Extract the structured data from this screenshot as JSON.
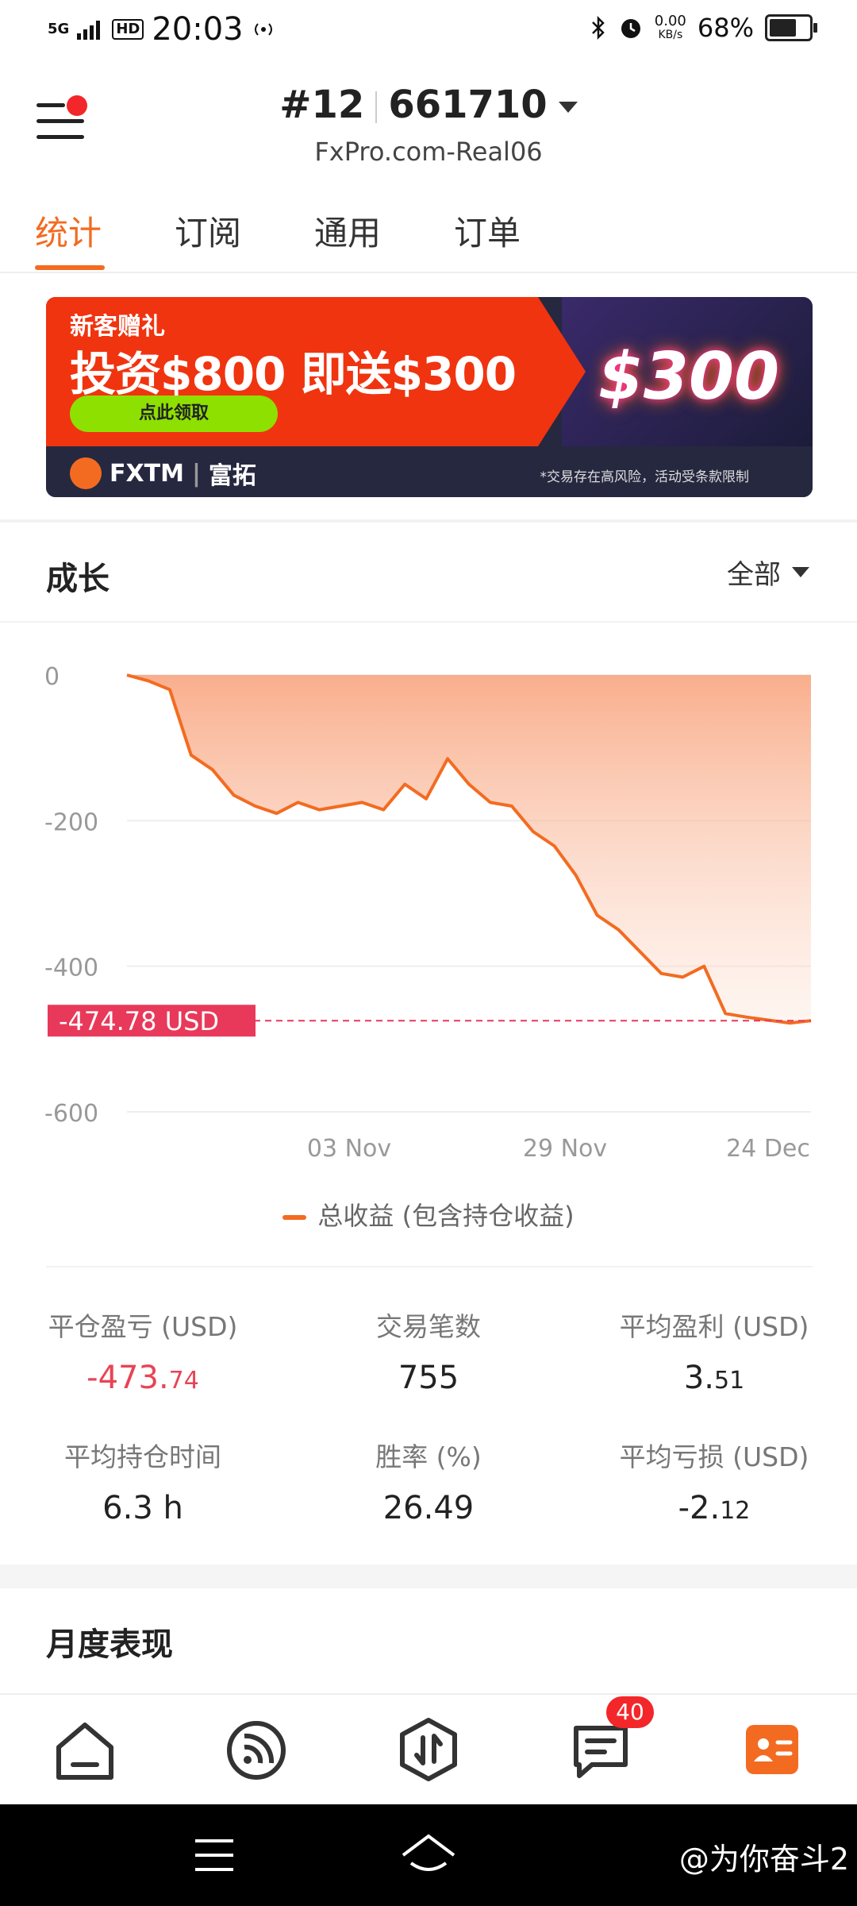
{
  "status_bar": {
    "network": "5G",
    "hd": "HD",
    "time": "20:03",
    "speed": "0.00",
    "speed_unit": "KB/s",
    "battery": "68%"
  },
  "header": {
    "account_prefix": "#12",
    "account_number": "661710",
    "server": "FxPro.com-Real06"
  },
  "tabs": [
    {
      "label": "统计",
      "active": true
    },
    {
      "label": "订阅",
      "active": false
    },
    {
      "label": "通用",
      "active": false
    },
    {
      "label": "订单",
      "active": false
    }
  ],
  "banner": {
    "line1": "新客赠礼",
    "line2": "投资$800 即送$300",
    "cta": "点此领取",
    "promo_amount": "$300",
    "brand": "FXTM",
    "brand_cn": "富拓",
    "risk_note": "*交易存在高风险，活动受条款限制"
  },
  "growth": {
    "title": "成长",
    "filter": "全部",
    "current_label": "-474.78  USD",
    "legend": "总收益 (包含持仓收益)"
  },
  "chart_data": {
    "type": "area",
    "title": "",
    "xlabel": "",
    "ylabel": "",
    "ylim": [
      -600,
      0
    ],
    "yticks": [
      0,
      -200,
      -400,
      -600
    ],
    "xticks": [
      "03  Nov",
      "29  Nov",
      "24  Dec"
    ],
    "series": [
      {
        "name": "总收益 (包含持仓收益)",
        "values": [
          0,
          -8,
          -20,
          -110,
          -130,
          -165,
          -180,
          -190,
          -175,
          -185,
          -180,
          -175,
          -185,
          -150,
          -170,
          -115,
          -150,
          -175,
          -180,
          -215,
          -235,
          -275,
          -330,
          -350,
          -380,
          -410,
          -415,
          -400,
          -465,
          -470,
          -474,
          -478,
          -474.78
        ]
      }
    ],
    "current_value": -474.78,
    "accent_color": "#f36b21",
    "marker_color": "#e8395a"
  },
  "stats": [
    {
      "label": "平仓盈亏 (USD)",
      "value_int": "-473.",
      "value_dec": "74",
      "negative": true
    },
    {
      "label": "交易笔数",
      "value_int": "755",
      "value_dec": "",
      "negative": false
    },
    {
      "label": "平均盈利 (USD)",
      "value_int": "3.",
      "value_dec": "51",
      "negative": false
    },
    {
      "label": "平均持仓时间",
      "value_int": "6.3 h",
      "value_dec": "",
      "negative": false
    },
    {
      "label": "胜率 (%)",
      "value_int": "26.49",
      "value_dec": "",
      "negative": false
    },
    {
      "label": "平均亏损 (USD)",
      "value_int": "-2.",
      "value_dec": "12",
      "negative": false
    }
  ],
  "monthly": {
    "title": "月度表现"
  },
  "bottom_nav": {
    "badge": "40",
    "items": [
      "home-icon",
      "feed-icon",
      "trade-icon",
      "message-icon",
      "profile-icon"
    ]
  },
  "system_bar": {
    "watermark": "@为你奋斗2"
  }
}
